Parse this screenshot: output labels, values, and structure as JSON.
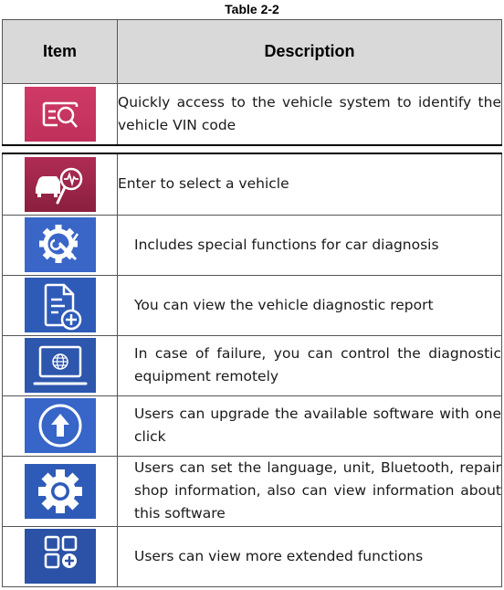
{
  "caption": "Table 2-2",
  "table": {
    "headers": {
      "item": "Item",
      "description": "Description"
    },
    "first_block": [
      {
        "icon": "vin-scan-icon",
        "icon_color": "#c83660",
        "description": "Quickly access to the vehicle system to identify the vehicle VIN code"
      }
    ],
    "second_block": [
      {
        "icon": "car-diagnosis-icon",
        "icon_color": "#9c2448",
        "description": "Enter to select a vehicle"
      },
      {
        "icon": "special-functions-icon",
        "icon_color": "#3a66c8",
        "description": "Includes special functions for car diagnosis"
      },
      {
        "icon": "diagnostic-report-icon",
        "icon_color": "#2f5bb8",
        "description": "You can view the vehicle diagnostic report"
      },
      {
        "icon": "remote-control-icon",
        "icon_color": "#2d56ad",
        "description": "In case of failure, you can control the diagnostic equipment remotely"
      },
      {
        "icon": "upgrade-icon",
        "icon_color": "#3765c8",
        "description": "Users can upgrade the available software with one click"
      },
      {
        "icon": "settings-icon",
        "icon_color": "#2f5bb8",
        "description": "Users can set the language, unit, Bluetooth, repair shop information, also can view information about this software"
      },
      {
        "icon": "more-functions-icon",
        "icon_color": "#2b52a6",
        "description": "Users can view more extended functions"
      }
    ]
  }
}
